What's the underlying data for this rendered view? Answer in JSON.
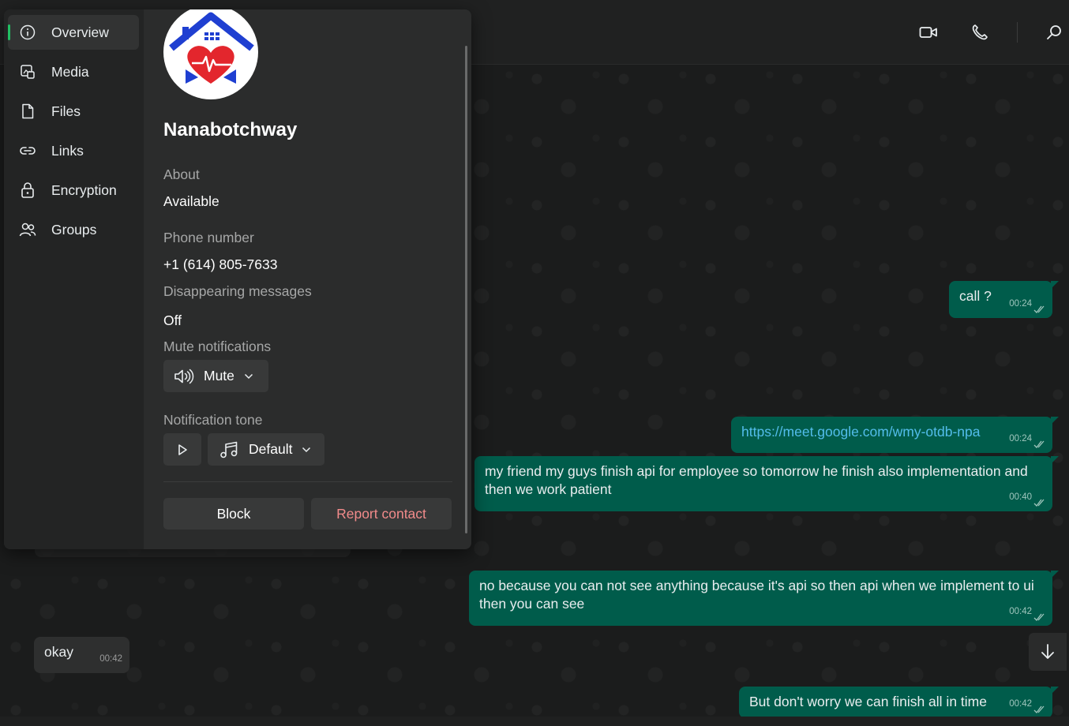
{
  "header": {
    "video_call_icon": "video-icon",
    "voice_call_icon": "phone-icon",
    "search_icon": "search-icon"
  },
  "panel": {
    "nav": [
      {
        "label": "Overview",
        "icon": "info-icon",
        "active": true
      },
      {
        "label": "Media",
        "icon": "media-icon",
        "active": false
      },
      {
        "label": "Files",
        "icon": "file-icon",
        "active": false
      },
      {
        "label": "Links",
        "icon": "link-icon",
        "active": false
      },
      {
        "label": "Encryption",
        "icon": "lock-icon",
        "active": false
      },
      {
        "label": "Groups",
        "icon": "groups-icon",
        "active": false
      }
    ],
    "contact_name": "Nanabotchway",
    "about_label": "About",
    "about_value": "Available",
    "phone_label": "Phone number",
    "phone_value": "+1 (614) 805-7633",
    "disappearing_label": "Disappearing messages",
    "disappearing_value": "Off",
    "mute_label": "Mute notifications",
    "mute_button": "Mute",
    "tone_label": "Notification tone",
    "tone_button": "Default",
    "block_button": "Block",
    "report_button": "Report contact"
  },
  "messages": [
    {
      "direction": "out",
      "text": "call ?",
      "time": "00:24",
      "link": false
    },
    {
      "direction": "out",
      "text": "https://meet.google.com/wmy-otdb-npa",
      "time": "00:24",
      "link": true
    },
    {
      "direction": "out",
      "text": "my friend my guys finish api for employee so tomorrow he finish also implementation and then we work patient",
      "time": "00:40",
      "link": false
    },
    {
      "direction": "out",
      "text": "no because you can not see anything because it's api so then api when we implement to ui then you can see",
      "time": "00:42",
      "link": false
    },
    {
      "direction": "in",
      "text": "okay",
      "time": "00:42",
      "link": false
    },
    {
      "direction": "out",
      "text": "But don't worry we can finish all in time",
      "time": "00:42",
      "link": false
    }
  ],
  "colors": {
    "outgoing_bubble": "#005c4b",
    "incoming_bubble": "#2e2f2f",
    "accent": "#21c063",
    "report_text": "#f28b8b",
    "link": "#53bdeb"
  }
}
